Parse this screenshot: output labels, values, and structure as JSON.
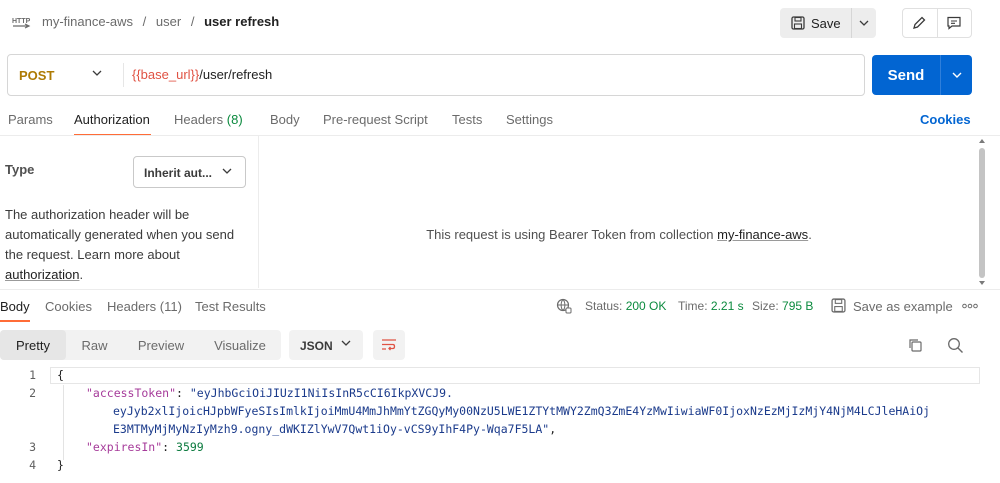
{
  "header": {
    "app_icon": "http-icon",
    "breadcrumb": [
      "my-finance-aws",
      "user",
      "user refresh"
    ],
    "separator": "/",
    "save_label": "Save",
    "icons": [
      "save-icon",
      "chevron-down-icon",
      "pencil-icon",
      "comment-icon"
    ]
  },
  "request": {
    "method": "POST",
    "url_variable": "{{base_url}}",
    "url_path": "/user/refresh",
    "send_label": "Send"
  },
  "request_tabs": [
    {
      "label": "Params"
    },
    {
      "label": "Authorization",
      "active": true
    },
    {
      "label": "Headers",
      "count": "(8)"
    },
    {
      "label": "Body"
    },
    {
      "label": "Pre-request Script"
    },
    {
      "label": "Tests"
    },
    {
      "label": "Settings"
    }
  ],
  "cookies_label": "Cookies",
  "auth": {
    "type_label": "Type",
    "type_value": "Inherit aut...",
    "help_text": "The authorization header will be automatically generated when you send the request. Learn more about",
    "help_link": "authorization",
    "help_end": ".",
    "message_prefix": "This request is using Bearer Token from collection",
    "message_link": "my-finance-aws",
    "message_suffix": "."
  },
  "response": {
    "tabs": [
      {
        "label": "Body",
        "active": true
      },
      {
        "label": "Cookies"
      },
      {
        "label": "Headers (11)"
      },
      {
        "label": "Test Results"
      }
    ],
    "status_label": "Status:",
    "status_value": "200 OK",
    "time_label": "Time:",
    "time_value": "2.21 s",
    "size_label": "Size:",
    "size_value": "795 B",
    "save_example_label": "Save as example",
    "more_label": "ooo",
    "view_modes": [
      "Pretty",
      "Raw",
      "Preview",
      "Visualize"
    ],
    "active_view": "Pretty",
    "format": "JSON",
    "line_numbers": [
      "1",
      "2",
      "3",
      "4"
    ],
    "code": {
      "open": "{",
      "access_key": "\"accessToken\"",
      "access_val_1": "\"eyJhbGciOiJIUzI1NiIsInR5cCI6IkpXVCJ9.",
      "access_val_2": "eyJyb2xlIjoicHJpbWFyeSIsImlkIjoiMmU4MmJhMmYtZGQyMy00NzU5LWE1ZTYtMWY2ZmQ3ZmE4YzMwIiwiaWF0IjoxNzEzMjIzMjY4NjM4LCJleHAiOj",
      "access_val_3": "E3MTMyMjMyNzIyMzh9.ogny_dWKIZlYwV7Qwt1iOy-vCS9yIhF4Py-Wqa7F5LA\"",
      "expires_key": "\"expiresIn\"",
      "expires_val": "3599",
      "close": "}"
    }
  }
}
